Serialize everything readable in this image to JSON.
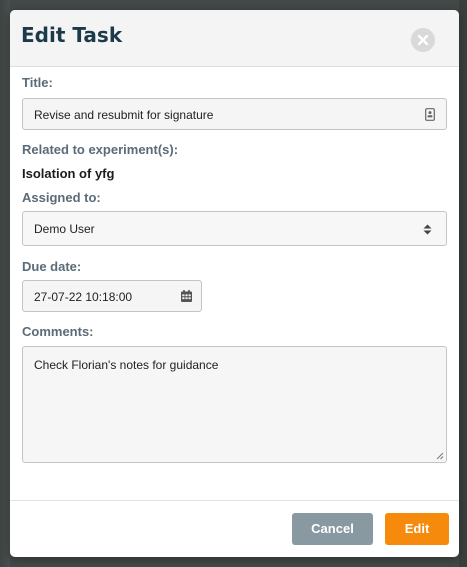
{
  "modal": {
    "title": "Edit Task",
    "close_icon": "close-icon"
  },
  "form": {
    "title_label": "Title:",
    "title_value": "Revise and resubmit for signature",
    "title_field_icon": "contact-card-icon",
    "experiments_label": "Related to experiment(s):",
    "experiment_name": "Isolation of yfg",
    "assigned_label": "Assigned to:",
    "assigned_value": "Demo User",
    "assigned_select_icon": "sort-arrows-icon",
    "due_label": "Due date:",
    "due_value": "27-07-22 10:18:00",
    "due_icon": "calendar-icon",
    "comments_label": "Comments:",
    "comments_value": "Check Florian's notes for guidance"
  },
  "footer": {
    "cancel_label": "Cancel",
    "edit_label": "Edit"
  },
  "colors": {
    "title": "#1d3a4a",
    "label": "#5b6b78",
    "cancel_button": "#8899a1",
    "edit_button": "#f58a0c"
  }
}
